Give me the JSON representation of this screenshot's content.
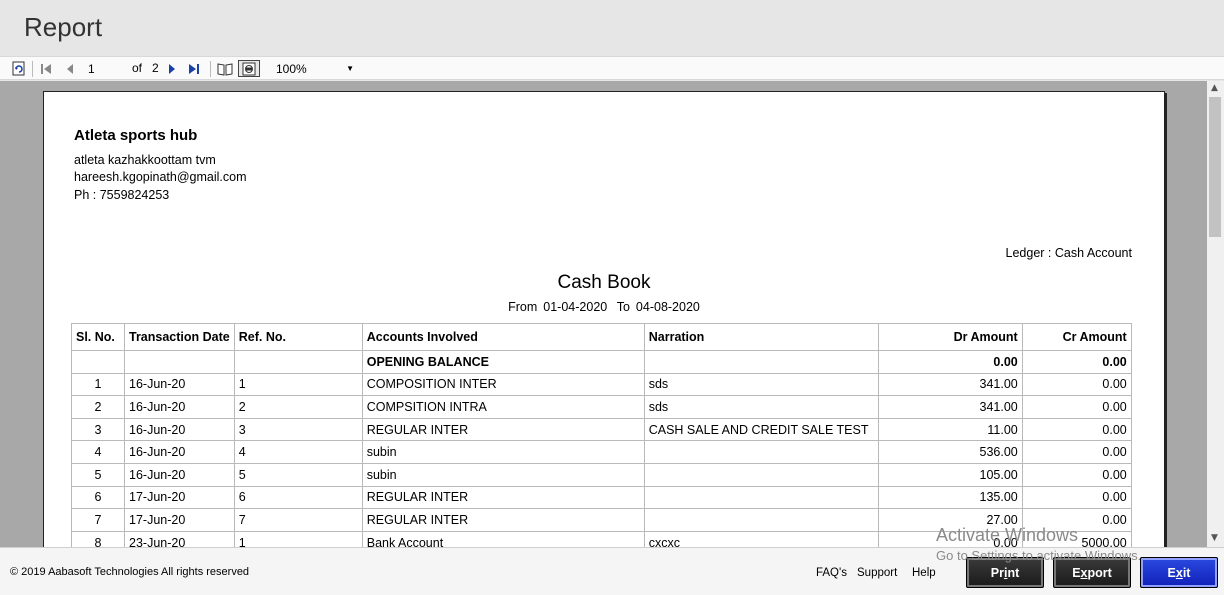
{
  "window": {
    "title": "Report"
  },
  "toolbar": {
    "current_page": "1",
    "of_label": "of",
    "total_pages": "2",
    "zoom": "100%"
  },
  "report": {
    "company": "Atleta sports hub",
    "address": "atleta kazhakkoottam tvm",
    "email": "hareesh.kgopinath@gmail.com",
    "phone": "Ph : 7559824253",
    "ledger": "Ledger : Cash Account",
    "title": "Cash Book",
    "range": {
      "from_label": "From",
      "from": "01-04-2020",
      "to_label": "To",
      "to": "04-08-2020"
    },
    "columns": [
      "Sl. No.",
      "Transaction Date",
      "Ref. No.",
      "Accounts Involved",
      "Narration",
      "Dr Amount",
      "Cr Amount"
    ],
    "rows": [
      {
        "sl": "",
        "date": "",
        "ref": "",
        "account": "OPENING BALANCE",
        "narration": "",
        "dr": "0.00",
        "cr": "0.00",
        "bold": true
      },
      {
        "sl": "1",
        "date": "16-Jun-20",
        "ref": "1",
        "account": "COMPOSITION INTER",
        "narration": "sds",
        "dr": "341.00",
        "cr": "0.00"
      },
      {
        "sl": "2",
        "date": "16-Jun-20",
        "ref": "2",
        "account": "COMPSITION INTRA",
        "narration": "sds",
        "dr": "341.00",
        "cr": "0.00"
      },
      {
        "sl": "3",
        "date": "16-Jun-20",
        "ref": "3",
        "account": "REGULAR INTER",
        "narration": "CASH SALE AND CREDIT SALE TEST",
        "dr": "11.00",
        "cr": "0.00"
      },
      {
        "sl": "4",
        "date": "16-Jun-20",
        "ref": "4",
        "account": "subin",
        "narration": "",
        "dr": "536.00",
        "cr": "0.00"
      },
      {
        "sl": "5",
        "date": "16-Jun-20",
        "ref": "5",
        "account": "subin",
        "narration": "",
        "dr": "105.00",
        "cr": "0.00"
      },
      {
        "sl": "6",
        "date": "17-Jun-20",
        "ref": "6",
        "account": "REGULAR INTER",
        "narration": "",
        "dr": "135.00",
        "cr": "0.00"
      },
      {
        "sl": "7",
        "date": "17-Jun-20",
        "ref": "7",
        "account": "REGULAR INTER",
        "narration": "",
        "dr": "27.00",
        "cr": "0.00"
      },
      {
        "sl": "8",
        "date": "23-Jun-20",
        "ref": "1",
        "account": "Bank Account",
        "narration": "cxcxc",
        "dr": "0.00",
        "cr": "5000.00"
      }
    ]
  },
  "watermark": {
    "line1": "Activate Windows",
    "line2": "Go to Settings to activate Windows."
  },
  "footer": {
    "copyright": "© 2019 Aabasoft Technologies All rights reserved",
    "faq": "FAQ's",
    "support": "Support",
    "help": "Help",
    "print_prefix": "Pr",
    "print_u": "i",
    "print_suffix": "nt",
    "export_prefix": "E",
    "export_u": "x",
    "export_suffix": "port",
    "exit_prefix": "E",
    "exit_u": "x",
    "exit_suffix": "it"
  }
}
